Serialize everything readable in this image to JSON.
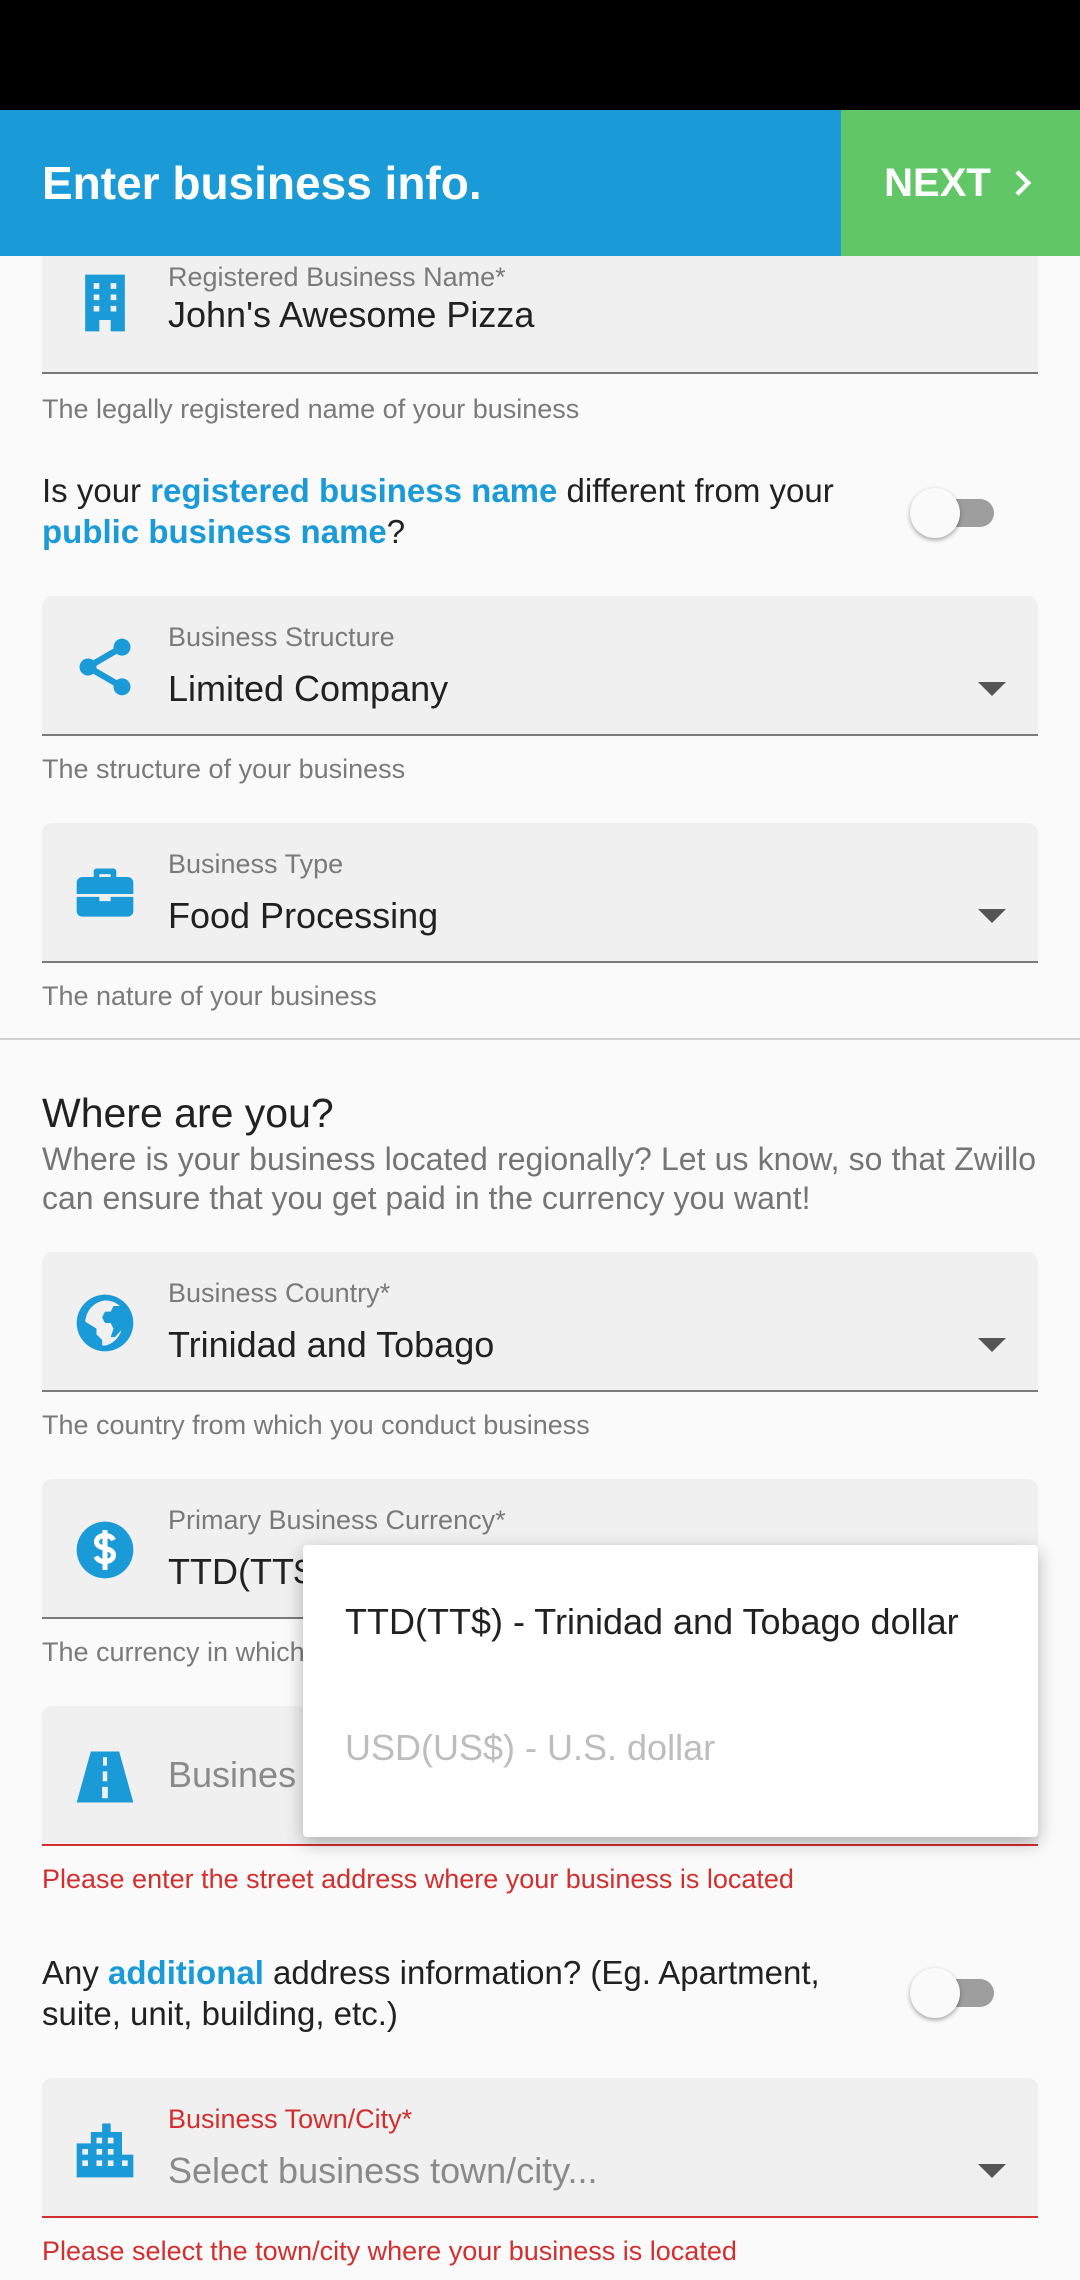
{
  "app_bar": {
    "title": "Enter business info.",
    "next_label": "NEXT",
    "background": "#1b9ad8",
    "next_background": "#61c766"
  },
  "business_name": {
    "label": "Registered Business Name*",
    "value": "John's Awesome Pizza",
    "helper": "The legally registered name of your business",
    "icon": "building-icon"
  },
  "public_name_question": {
    "part1": "Is your ",
    "link1": "registered business name",
    "part2": " different from your ",
    "link2": "public business name",
    "part3": "?"
  },
  "business_structure": {
    "label": "Business Structure",
    "value": "Limited Company",
    "helper": "The structure of your business",
    "icon": "share-icon"
  },
  "business_type": {
    "label": "Business Type",
    "value": "Food Processing",
    "helper": "The nature of your business",
    "icon": "briefcase-icon"
  },
  "location_section": {
    "title": "Where are you?",
    "description": "Where is your business located regionally? Let us know, so that Zwillo can ensure that you get paid in the currency you want!"
  },
  "business_country": {
    "label": "Business Country*",
    "value": "Trinidad and Tobago",
    "helper": "The country from which you conduct business",
    "icon": "globe-icon"
  },
  "business_currency": {
    "label": "Primary Business Currency*",
    "value_visible": "TTD(TT$",
    "helper_visible": "The currency in which",
    "icon": "dollar-icon"
  },
  "currency_menu": {
    "options": [
      {
        "label": "TTD(TT$) - Trinidad and Tobago dollar",
        "state": "selected"
      },
      {
        "label": "USD(US$) - U.S. dollar",
        "state": "disabled"
      }
    ]
  },
  "business_address": {
    "placeholder_visible": "Busines",
    "error": "Please enter the street address where your business is located",
    "icon": "road-icon"
  },
  "additional_address_question": {
    "part1": "Any ",
    "link": "additional",
    "part2": " address information? (Eg. Apartment, suite, unit, building, etc.)"
  },
  "business_city": {
    "label": "Business Town/City*",
    "placeholder": "Select business town/city...",
    "error": "Please select the town/city where your business is located",
    "icon": "city-icon"
  },
  "colors": {
    "accent": "#1b9ad8",
    "error": "#d32f2f",
    "success": "#61c766"
  }
}
